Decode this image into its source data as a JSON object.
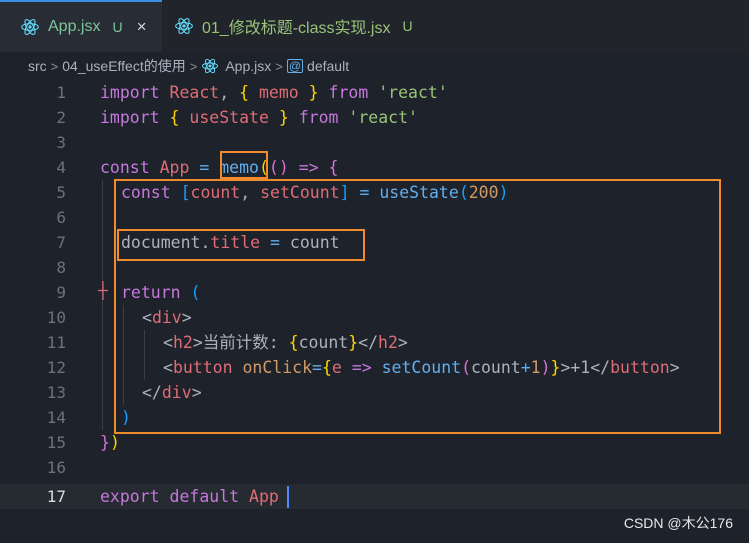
{
  "tabs": [
    {
      "name": "App.jsx",
      "modified": "U",
      "close": "×"
    },
    {
      "name": "01_修改标题-class实现.jsx",
      "modified": "U"
    }
  ],
  "breadcrumb": {
    "segments": [
      "src",
      "04_useEffect的使用",
      "App.jsx",
      "default"
    ],
    "separator": ">"
  },
  "editor": {
    "current_line": 17,
    "line_numbers": [
      "1",
      "2",
      "3",
      "4",
      "5",
      "6",
      "7",
      "8",
      "9",
      "10",
      "11",
      "12",
      "13",
      "14",
      "15",
      "16",
      "17"
    ],
    "tokens": {
      "import": "import",
      "React": "React",
      "comma": ",",
      "lbrace": "{",
      "rbrace": "}",
      "memo": "memo",
      "from": "from",
      "react_str": "'react'",
      "useState": "useState",
      "const": "const",
      "App": "App",
      "eq": "=",
      "arrow": "=>",
      "lparen": "(",
      "rparen": ")",
      "lbracket": "[",
      "rbracket": "]",
      "count": "count",
      "setCount": "setCount",
      "n200": "200",
      "document": "document",
      "dot": ".",
      "title": "title",
      "return": "return",
      "lt": "<",
      "gt": ">",
      "lt_slash": "</",
      "div": "div",
      "h2": "h2",
      "h2_text": "当前计数: ",
      "button": "button",
      "onClick": "onClick",
      "e": "e",
      "plus": "+",
      "n1": "1",
      "plus1": "+1",
      "export": "export",
      "default": "default"
    }
  },
  "watermark": "CSDN @木公176",
  "colors": {
    "highlight_box": "#f08c2d",
    "active_tab_border": "#3a8ee6",
    "background": "#1e222a"
  }
}
